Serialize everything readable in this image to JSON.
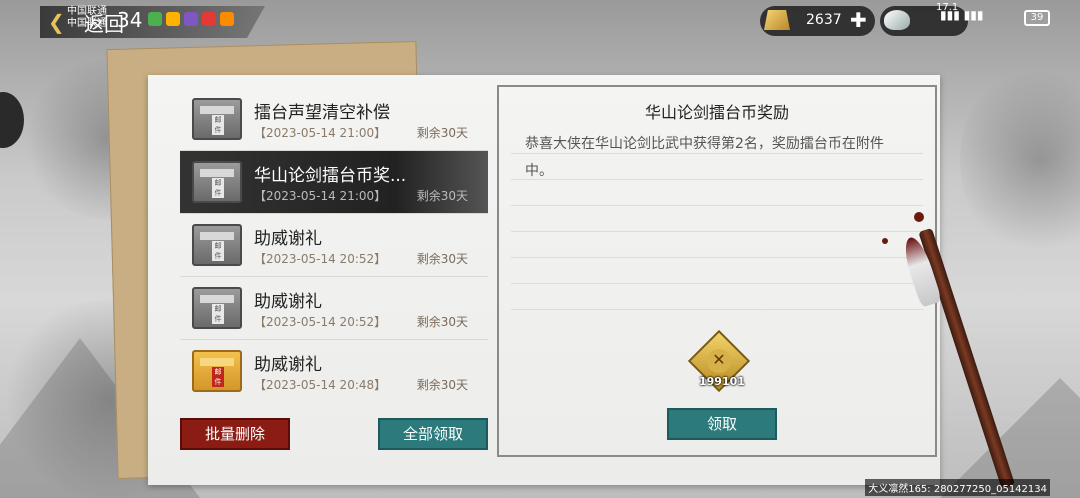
{
  "statusbar": {
    "carrier": "中国联通\n中国联通",
    "back_label": "返回",
    "clock": "34",
    "gold": "2637",
    "silver": "17.1",
    "battery": "39"
  },
  "mail_list": [
    {
      "title": "擂台声望清空补偿",
      "date": "【2023-05-14 21:00】",
      "remain": "剩余30天",
      "envelope": "gray",
      "selected": false
    },
    {
      "title": "华山论剑擂台币奖...",
      "date": "【2023-05-14 21:00】",
      "remain": "剩余30天",
      "envelope": "gray",
      "selected": true
    },
    {
      "title": "助威谢礼",
      "date": "【2023-05-14 20:52】",
      "remain": "剩余30天",
      "envelope": "gray",
      "selected": false
    },
    {
      "title": "助威谢礼",
      "date": "【2023-05-14 20:52】",
      "remain": "剩余30天",
      "envelope": "gray",
      "selected": false
    },
    {
      "title": "助威谢礼",
      "date": "【2023-05-14 20:48】",
      "remain": "剩余30天",
      "envelope": "gold",
      "selected": false
    }
  ],
  "envelope_label": "邮件",
  "actions": {
    "batch_delete": "批量删除",
    "claim_all": "全部领取"
  },
  "detail": {
    "title": "华山论剑擂台币奖励",
    "body": "恭喜大侠在华山论剑比武中获得第2名，奖励擂台币在附件中。",
    "reward_count": "199101",
    "claim": "领取"
  },
  "watermark": "大义凛然165: 280277250_05142134",
  "colors": {
    "gold_envelope": "#d3962a",
    "teal_button": "#2c7a7c",
    "red_button": "#8a1c14"
  }
}
